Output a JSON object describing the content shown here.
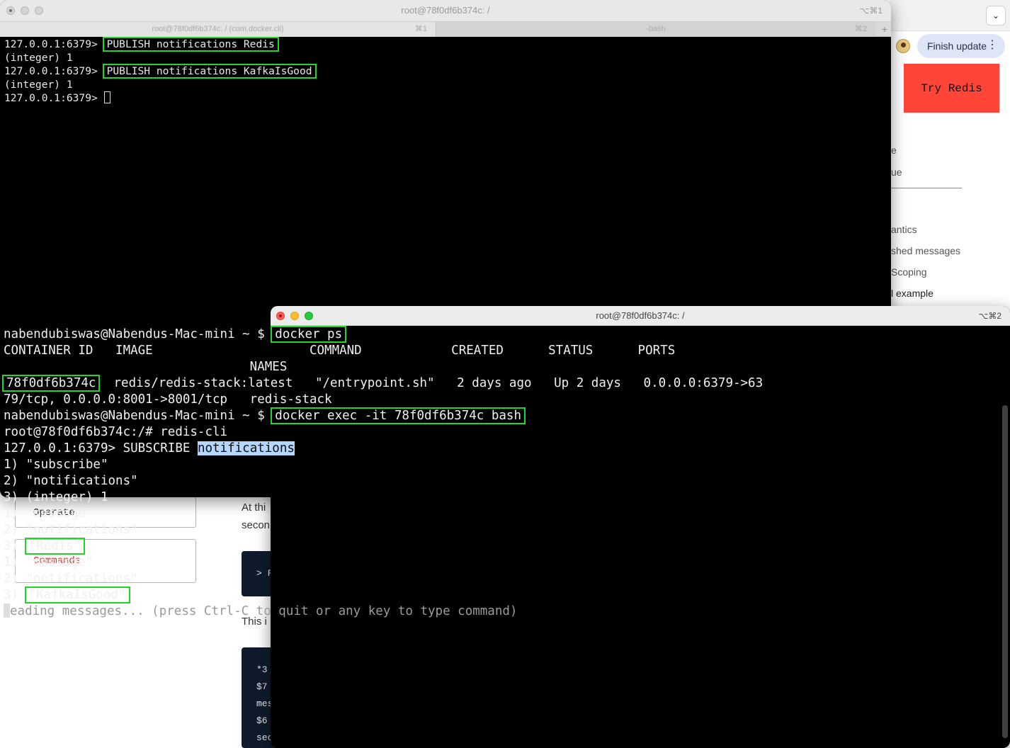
{
  "browser": {
    "finish_update_label": "Finish update",
    "try_redis_label": "Try Redis",
    "toc": [
      "e",
      "ue",
      "antics",
      "shed messages",
      "Scoping",
      "l example"
    ],
    "cards": {
      "operate": "Operate",
      "commands": "Commands"
    },
    "text_fragments": [
      "At thi",
      "secon",
      "This i"
    ],
    "code_block_1": [
      "> F"
    ],
    "code_block_2": [
      "*3",
      "$7",
      "mes",
      "$6",
      "second"
    ]
  },
  "terminal1": {
    "title": "root@78f0df6b374c: /",
    "shortcut": "⌥⌘1",
    "tabs": [
      {
        "label": "root@78f0df6b374c: / (com.docker.cli)",
        "key": "⌘1"
      },
      {
        "label": "-bash",
        "key": "⌘2"
      }
    ],
    "add_tab": "+",
    "lines": {
      "l1_prompt": "127.0.0.1:6379> ",
      "l1_cmd": "PUBLISH notifications Redis",
      "l2": "(integer) 1",
      "l3_prompt": "127.0.0.1:6379> ",
      "l3_cmd": "PUBLISH notifications KafkaIsGood",
      "l4": "(integer) 1",
      "l5_prompt": "127.0.0.1:6379> "
    }
  },
  "terminal2": {
    "title": "root@78f0df6b374c: /",
    "shortcut": "⌥⌘2",
    "lines": {
      "p1": "nabendubiswas@Nabendus-Mac-mini ~ $ ",
      "c1": "docker ps",
      "header": "CONTAINER ID   IMAGE                     COMMAND            CREATED      STATUS      PORTS",
      "header2": "                                 NAMES",
      "container_id": "78f0df6b374c",
      "row_rest": "  redis/redis-stack:latest   \"/entrypoint.sh\"   2 days ago   Up 2 days   0.0.0.0:6379->63",
      "row_wrap": "79/tcp, 0.0.0.0:8001->8001/tcp   redis-stack",
      "p2": "nabendubiswas@Nabendus-Mac-mini ~ $ ",
      "c2": "docker exec -it 78f0df6b374c bash",
      "l_rootcli": "root@78f0df6b374c:/# redis-cli",
      "sub_prompt": "127.0.0.1:6379> SUBSCRIBE ",
      "sub_channel": "notifications",
      "r1": "1) \"subscribe\"",
      "r2": "2) \"notifications\"",
      "r3": "3) (integer) 1",
      "m1": "1) \"message\"",
      "m2": "2) \"notifications\"",
      "m3_prefix": "3) ",
      "m3_val": "\"Redis\"",
      "n1": "1) \"message\"",
      "n2": "2) \"notifications\"",
      "n3_prefix": "3) ",
      "n3_val": "\"KafkaIsGood\"",
      "reading": "eading messages... (press Ctrl-C to quit or any key to type command)"
    }
  }
}
